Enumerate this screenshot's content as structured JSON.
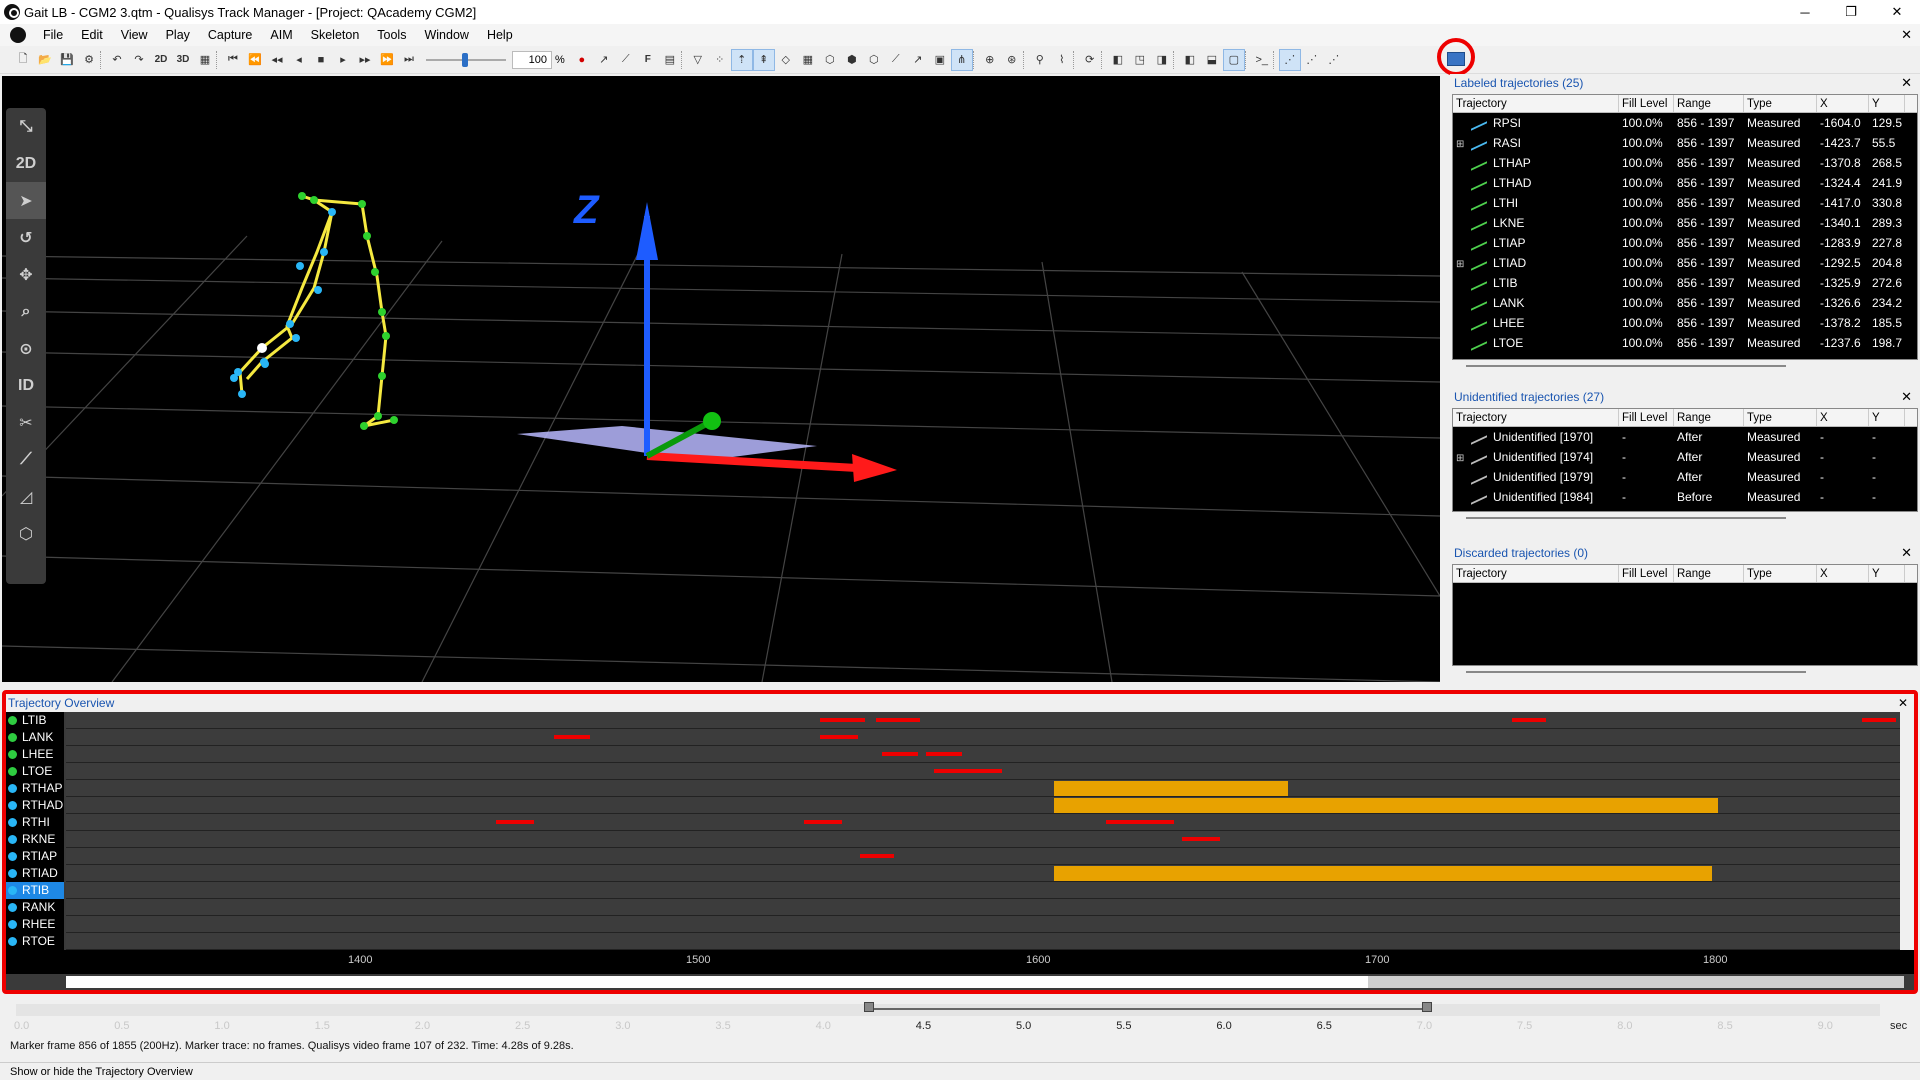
{
  "window": {
    "title": "Gait LB - CGM2 3.qtm - Qualisys Track Manager - [Project: QAcademy CGM2]",
    "min": "─",
    "max": "❐",
    "close": "✕"
  },
  "menu": [
    "File",
    "Edit",
    "View",
    "Play",
    "Capture",
    "AIM",
    "Skeleton",
    "Tools",
    "Window",
    "Help"
  ],
  "menu_close": "✕",
  "toolbar": {
    "btn_2d": "2D",
    "btn_3d": "3D",
    "btn_f": "F",
    "speed_value": "100",
    "speed_unit": "%"
  },
  "view3d": {
    "axis_label": "Z",
    "side_2d": "2D",
    "side_id": "ID"
  },
  "labeled": {
    "title": "Labeled trajectories (25)",
    "headers": [
      "Trajectory",
      "Fill Level",
      "Range",
      "Type",
      "X",
      "Y"
    ],
    "rows": [
      {
        "name": "RPSI",
        "fill": "100.0%",
        "range": "856 - 1397",
        "type": "Measured",
        "x": "-1604.0",
        "y": "129.5",
        "expander": "",
        "color": "blue"
      },
      {
        "name": "RASI",
        "fill": "100.0%",
        "range": "856 - 1397",
        "type": "Measured",
        "x": "-1423.7",
        "y": "55.5",
        "expander": "⊞",
        "color": "blue"
      },
      {
        "name": "LTHAP",
        "fill": "100.0%",
        "range": "856 - 1397",
        "type": "Measured",
        "x": "-1370.8",
        "y": "268.5",
        "expander": "",
        "color": "green"
      },
      {
        "name": "LTHAD",
        "fill": "100.0%",
        "range": "856 - 1397",
        "type": "Measured",
        "x": "-1324.4",
        "y": "241.9",
        "expander": "",
        "color": "green"
      },
      {
        "name": "LTHI",
        "fill": "100.0%",
        "range": "856 - 1397",
        "type": "Measured",
        "x": "-1417.0",
        "y": "330.8",
        "expander": "",
        "color": "green"
      },
      {
        "name": "LKNE",
        "fill": "100.0%",
        "range": "856 - 1397",
        "type": "Measured",
        "x": "-1340.1",
        "y": "289.3",
        "expander": "",
        "color": "green"
      },
      {
        "name": "LTIAP",
        "fill": "100.0%",
        "range": "856 - 1397",
        "type": "Measured",
        "x": "-1283.9",
        "y": "227.8",
        "expander": "",
        "color": "green"
      },
      {
        "name": "LTIAD",
        "fill": "100.0%",
        "range": "856 - 1397",
        "type": "Measured",
        "x": "-1292.5",
        "y": "204.8",
        "expander": "⊞",
        "color": "green"
      },
      {
        "name": "LTIB",
        "fill": "100.0%",
        "range": "856 - 1397",
        "type": "Measured",
        "x": "-1325.9",
        "y": "272.6",
        "expander": "",
        "color": "green"
      },
      {
        "name": "LANK",
        "fill": "100.0%",
        "range": "856 - 1397",
        "type": "Measured",
        "x": "-1326.6",
        "y": "234.2",
        "expander": "",
        "color": "green"
      },
      {
        "name": "LHEE",
        "fill": "100.0%",
        "range": "856 - 1397",
        "type": "Measured",
        "x": "-1378.2",
        "y": "185.5",
        "expander": "",
        "color": "green"
      },
      {
        "name": "LTOE",
        "fill": "100.0%",
        "range": "856 - 1397",
        "type": "Measured",
        "x": "-1237.6",
        "y": "198.7",
        "expander": "",
        "color": "green"
      }
    ]
  },
  "unidentified": {
    "title": "Unidentified trajectories (27)",
    "headers": [
      "Trajectory",
      "Fill Level",
      "Range",
      "Type",
      "X",
      "Y"
    ],
    "rows": [
      {
        "name": "Unidentified [1970]",
        "fill": "-",
        "range": "After",
        "type": "Measured",
        "x": "-",
        "y": "-",
        "expander": ""
      },
      {
        "name": "Unidentified [1974]",
        "fill": "-",
        "range": "After",
        "type": "Measured",
        "x": "-",
        "y": "-",
        "expander": "⊞"
      },
      {
        "name": "Unidentified [1979]",
        "fill": "-",
        "range": "After",
        "type": "Measured",
        "x": "-",
        "y": "-",
        "expander": ""
      },
      {
        "name": "Unidentified [1984]",
        "fill": "-",
        "range": "Before",
        "type": "Measured",
        "x": "-",
        "y": "-",
        "expander": ""
      }
    ]
  },
  "discarded": {
    "title": "Discarded trajectories (0)",
    "headers": [
      "Trajectory",
      "Fill Level",
      "Range",
      "Type",
      "X",
      "Y"
    ]
  },
  "overview": {
    "title": "Trajectory Overview",
    "close": "✕",
    "rows": [
      {
        "name": "LTIB",
        "dot": "#2ecc40",
        "selected": false
      },
      {
        "name": "LANK",
        "dot": "#2ecc40",
        "selected": false
      },
      {
        "name": "LHEE",
        "dot": "#2ecc40",
        "selected": false
      },
      {
        "name": "LTOE",
        "dot": "#2ecc40",
        "selected": false
      },
      {
        "name": "RTHAP",
        "dot": "#29b6f6",
        "selected": false
      },
      {
        "name": "RTHAD",
        "dot": "#29b6f6",
        "selected": false
      },
      {
        "name": "RTHI",
        "dot": "#29b6f6",
        "selected": false
      },
      {
        "name": "RKNE",
        "dot": "#29b6f6",
        "selected": false
      },
      {
        "name": "RTIAP",
        "dot": "#29b6f6",
        "selected": false
      },
      {
        "name": "RTIAD",
        "dot": "#29b6f6",
        "selected": false
      },
      {
        "name": "RTIB",
        "dot": "#29b6f6",
        "selected": true
      },
      {
        "name": "RANK",
        "dot": "#29b6f6",
        "selected": false
      },
      {
        "name": "RHEE",
        "dot": "#29b6f6",
        "selected": false
      },
      {
        "name": "RTOE",
        "dot": "#29b6f6",
        "selected": false
      }
    ],
    "frame_ticks": [
      "1400",
      "1500",
      "1600",
      "1700",
      "1800"
    ]
  },
  "timeline": {
    "ticks": [
      "0.0",
      "0.5",
      "1.0",
      "1.5",
      "2.0",
      "2.5",
      "3.0",
      "3.5",
      "4.0",
      "4.5",
      "5.0",
      "5.5",
      "6.0",
      "6.5",
      "7.0",
      "7.5",
      "8.0",
      "8.5",
      "9.0"
    ],
    "unit": "sec"
  },
  "status": {
    "frame_info": "Marker frame 856 of 1855 (200Hz). Marker trace: no frames. Qualisys video frame 107 of 232. Time: 4.28s of 9.28s.",
    "hint": "Show or hide the Trajectory Overview"
  },
  "colors": {
    "gap": "#e00000",
    "filled": "#e8a200",
    "highlight": "#e00000"
  }
}
